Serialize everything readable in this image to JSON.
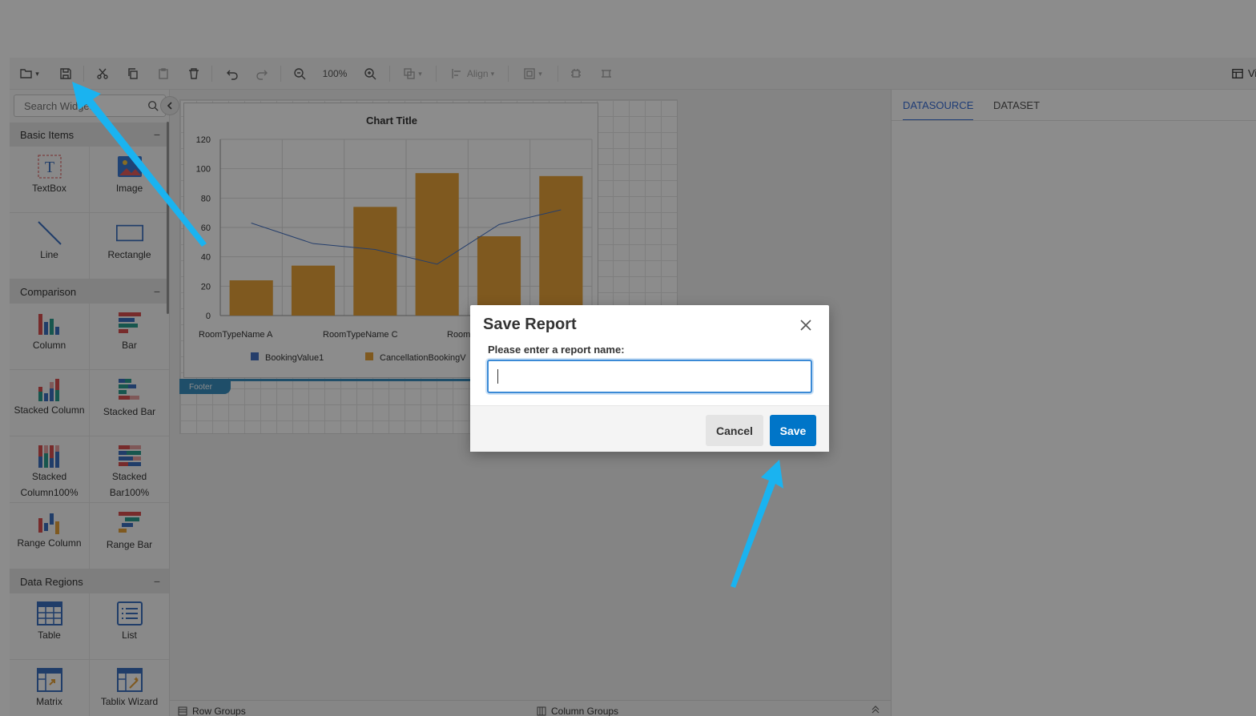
{
  "toolbar": {
    "zoom": "100%",
    "align_label": "Align",
    "view_label": "Vi"
  },
  "palette": {
    "search_placeholder": "Search Widgets",
    "sections": [
      {
        "title": "Basic Items",
        "items": [
          "TextBox",
          "Image",
          "Line",
          "Rectangle"
        ]
      },
      {
        "title": "Comparison",
        "items": [
          "Column",
          "Bar",
          "Stacked Column",
          "Stacked Bar",
          "Stacked Column100%",
          "Stacked Bar100%",
          "Range Column",
          "Range Bar"
        ]
      },
      {
        "title": "Data Regions",
        "items": [
          "Table",
          "List",
          "Matrix",
          "Tablix Wizard"
        ]
      }
    ],
    "collapse_symbol": "−"
  },
  "right_panel": {
    "tabs": [
      "DATASOURCE",
      "DATASET"
    ]
  },
  "canvas": {
    "footer_label": "Footer"
  },
  "groups": {
    "row": "Row Groups",
    "column": "Column Groups"
  },
  "dialog": {
    "title": "Save Report",
    "label": "Please enter a report name:",
    "value": "",
    "cancel": "Cancel",
    "save": "Save"
  },
  "colors": {
    "bar": "#e8a33a",
    "line": "#4472c4",
    "accent": "#0075c8",
    "arrow": "#1ab3f0"
  },
  "chart_data": {
    "type": "bar",
    "title": "Chart Title",
    "categories": [
      "RoomTypeName A",
      "",
      "RoomTypeName C",
      "",
      "RoomTypeName E",
      ""
    ],
    "category_labels_visible": [
      "RoomTypeName A",
      "RoomTypeName C",
      "Room"
    ],
    "ylim": [
      0,
      120
    ],
    "yticks": [
      0,
      20,
      40,
      60,
      80,
      100,
      120
    ],
    "series": [
      {
        "name": "BookingValue1",
        "type": "line",
        "values": [
          63,
          49,
          45,
          35,
          62,
          72
        ]
      },
      {
        "name": "CancellationBookingV",
        "type": "bar",
        "values": [
          24,
          34,
          74,
          97,
          54,
          95
        ]
      }
    ]
  }
}
